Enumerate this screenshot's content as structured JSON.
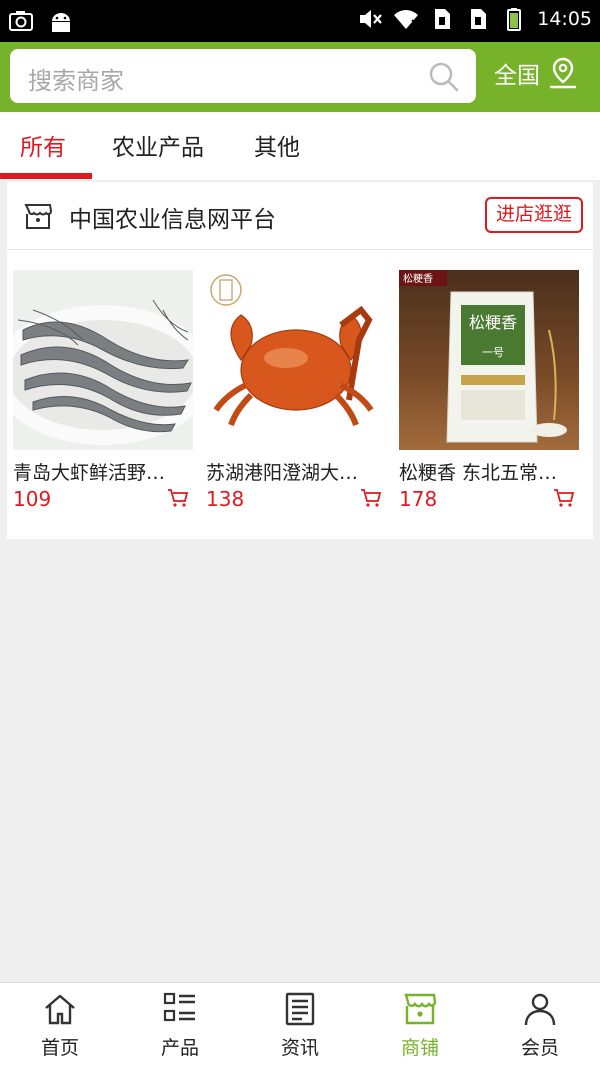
{
  "status_bar": {
    "time": "14:05"
  },
  "search": {
    "placeholder": "搜索商家"
  },
  "region": {
    "label": "全国"
  },
  "tabs": [
    {
      "label": "所有",
      "active": true
    },
    {
      "label": "农业产品",
      "active": false
    },
    {
      "label": "其他",
      "active": false
    }
  ],
  "store": {
    "name": "中国农业信息网平台",
    "visit_label": "进店逛逛",
    "products": [
      {
        "name": "青岛大虾鲜活野…",
        "price": "109"
      },
      {
        "name": "苏湖港阳澄湖大…",
        "price": "138"
      },
      {
        "name": "松粳香 东北五常…",
        "price": "178"
      }
    ]
  },
  "rice_bag": {
    "brand_tag": "松粳香",
    "bag_title": "松粳香",
    "bag_sub": "一号"
  },
  "bottom_nav": [
    {
      "label": "首页",
      "icon": "home-icon",
      "active": false
    },
    {
      "label": "产品",
      "icon": "list-icon",
      "active": false
    },
    {
      "label": "资讯",
      "icon": "news-icon",
      "active": false
    },
    {
      "label": "商铺",
      "icon": "shop-icon",
      "active": true
    },
    {
      "label": "会员",
      "icon": "user-icon",
      "active": false
    }
  ],
  "colors": {
    "accent_green": "#77b32a",
    "accent_red": "#e0191e"
  }
}
